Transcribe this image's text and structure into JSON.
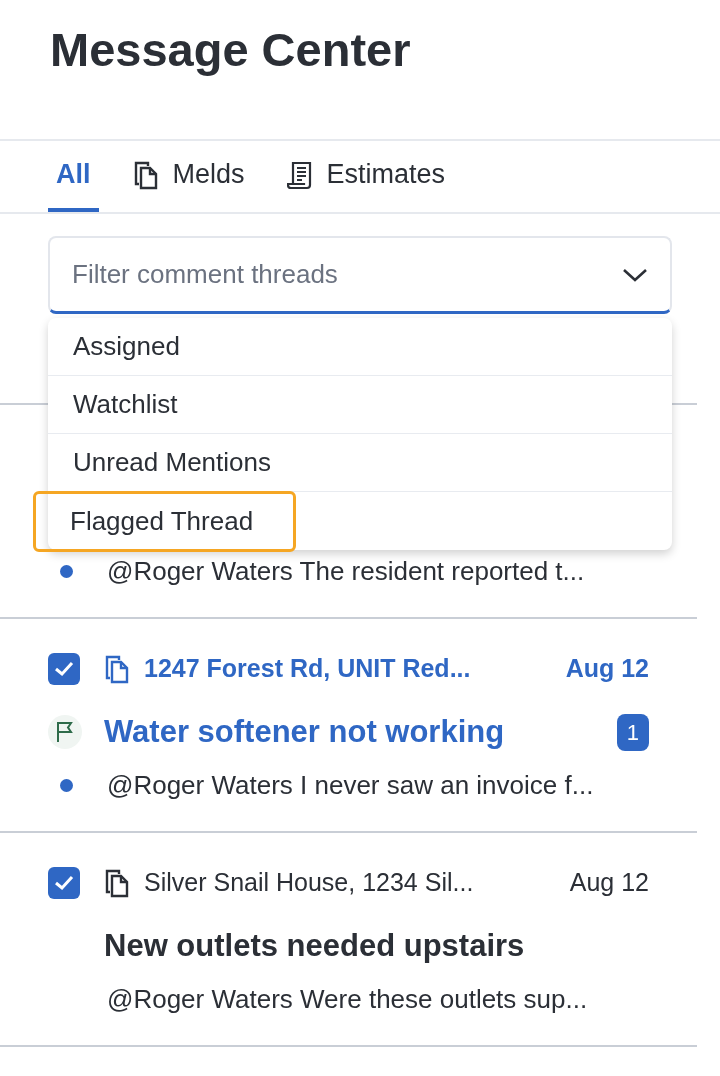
{
  "header": {
    "title": "Message Center"
  },
  "tabs": [
    {
      "label": "All",
      "kind": "text",
      "selected": true
    },
    {
      "label": "Melds",
      "kind": "document",
      "selected": false
    },
    {
      "label": "Estimates",
      "kind": "receipt",
      "selected": false
    }
  ],
  "filter": {
    "placeholder": "Filter comment threads",
    "expanded": true,
    "options": [
      {
        "label": "Assigned",
        "highlighted": false
      },
      {
        "label": "Watchlist",
        "highlighted": false
      },
      {
        "label": "Unread Mentions",
        "highlighted": false
      },
      {
        "label": "Flagged Thread",
        "highlighted": true
      }
    ]
  },
  "threads": [
    {
      "unread": true,
      "preview": "@Roger Waters The resident reported t..."
    },
    {
      "checked": true,
      "location": "1247 Forest Rd, UNIT Red...",
      "date": "Aug 12",
      "title": "Water softener not working",
      "flagged": true,
      "unread_count": "1",
      "unread": true,
      "preview": "@Roger Waters I never saw an invoice f..."
    },
    {
      "checked": true,
      "location": "Silver Snail House, 1234 Sil...",
      "date": "Aug 12",
      "title": "New outlets needed upstairs",
      "flagged": false,
      "unread": false,
      "preview": "@Roger Waters Were these outlets sup..."
    }
  ]
}
